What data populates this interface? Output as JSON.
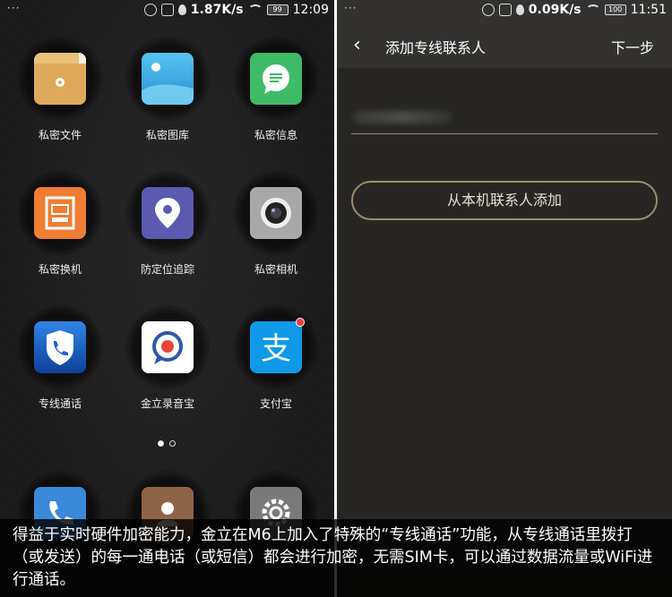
{
  "left_screen": {
    "status": {
      "dots": "···",
      "speed": "1.87K/s",
      "battery": "99",
      "time": "12:09"
    },
    "apps": [
      {
        "label": "私密文件",
        "icon": "folder-icon",
        "color": "#e8b96a"
      },
      {
        "label": "私密图库",
        "icon": "gallery-icon",
        "color": "#3fa9e0"
      },
      {
        "label": "私密信息",
        "icon": "message-icon",
        "color": "#3dbb67"
      },
      {
        "label": "私密换机",
        "icon": "transfer-icon",
        "color": "#f07d32"
      },
      {
        "label": "防定位追踪",
        "icon": "location-pin-icon",
        "color": "#5a5bb0"
      },
      {
        "label": "私密相机",
        "icon": "camera-icon",
        "color": "#9a9a9a"
      },
      {
        "label": "专线通话",
        "icon": "shield-phone-icon",
        "color": "#1e6bd0"
      },
      {
        "label": "金立录音宝",
        "icon": "recorder-icon",
        "color": "#ffffff"
      },
      {
        "label": "支付宝",
        "icon": "alipay-icon",
        "color": "#0e9ae8"
      }
    ],
    "dock_apps": [
      {
        "icon": "phone-icon",
        "color": "#3a8ad9"
      },
      {
        "icon": "contacts-icon",
        "color": "#9a6b4b"
      },
      {
        "icon": "settings-icon",
        "color": "#8a8a8a"
      }
    ]
  },
  "right_screen": {
    "status": {
      "dots": "···",
      "speed": "0.09K/s",
      "battery": "100",
      "time": "11:51"
    },
    "title": "添加专线联系人",
    "next_label": "下一步",
    "add_button_label": "从本机联系人添加"
  },
  "caption": "得益于实时硬件加密能力，金立在M6上加入了特殊的“专线通话”功能，从专线通话里拨打（或发送）的每一通电话（或短信）都会进行加密，无需SIM卡，可以通过数据流量或WiFi进行通话。"
}
